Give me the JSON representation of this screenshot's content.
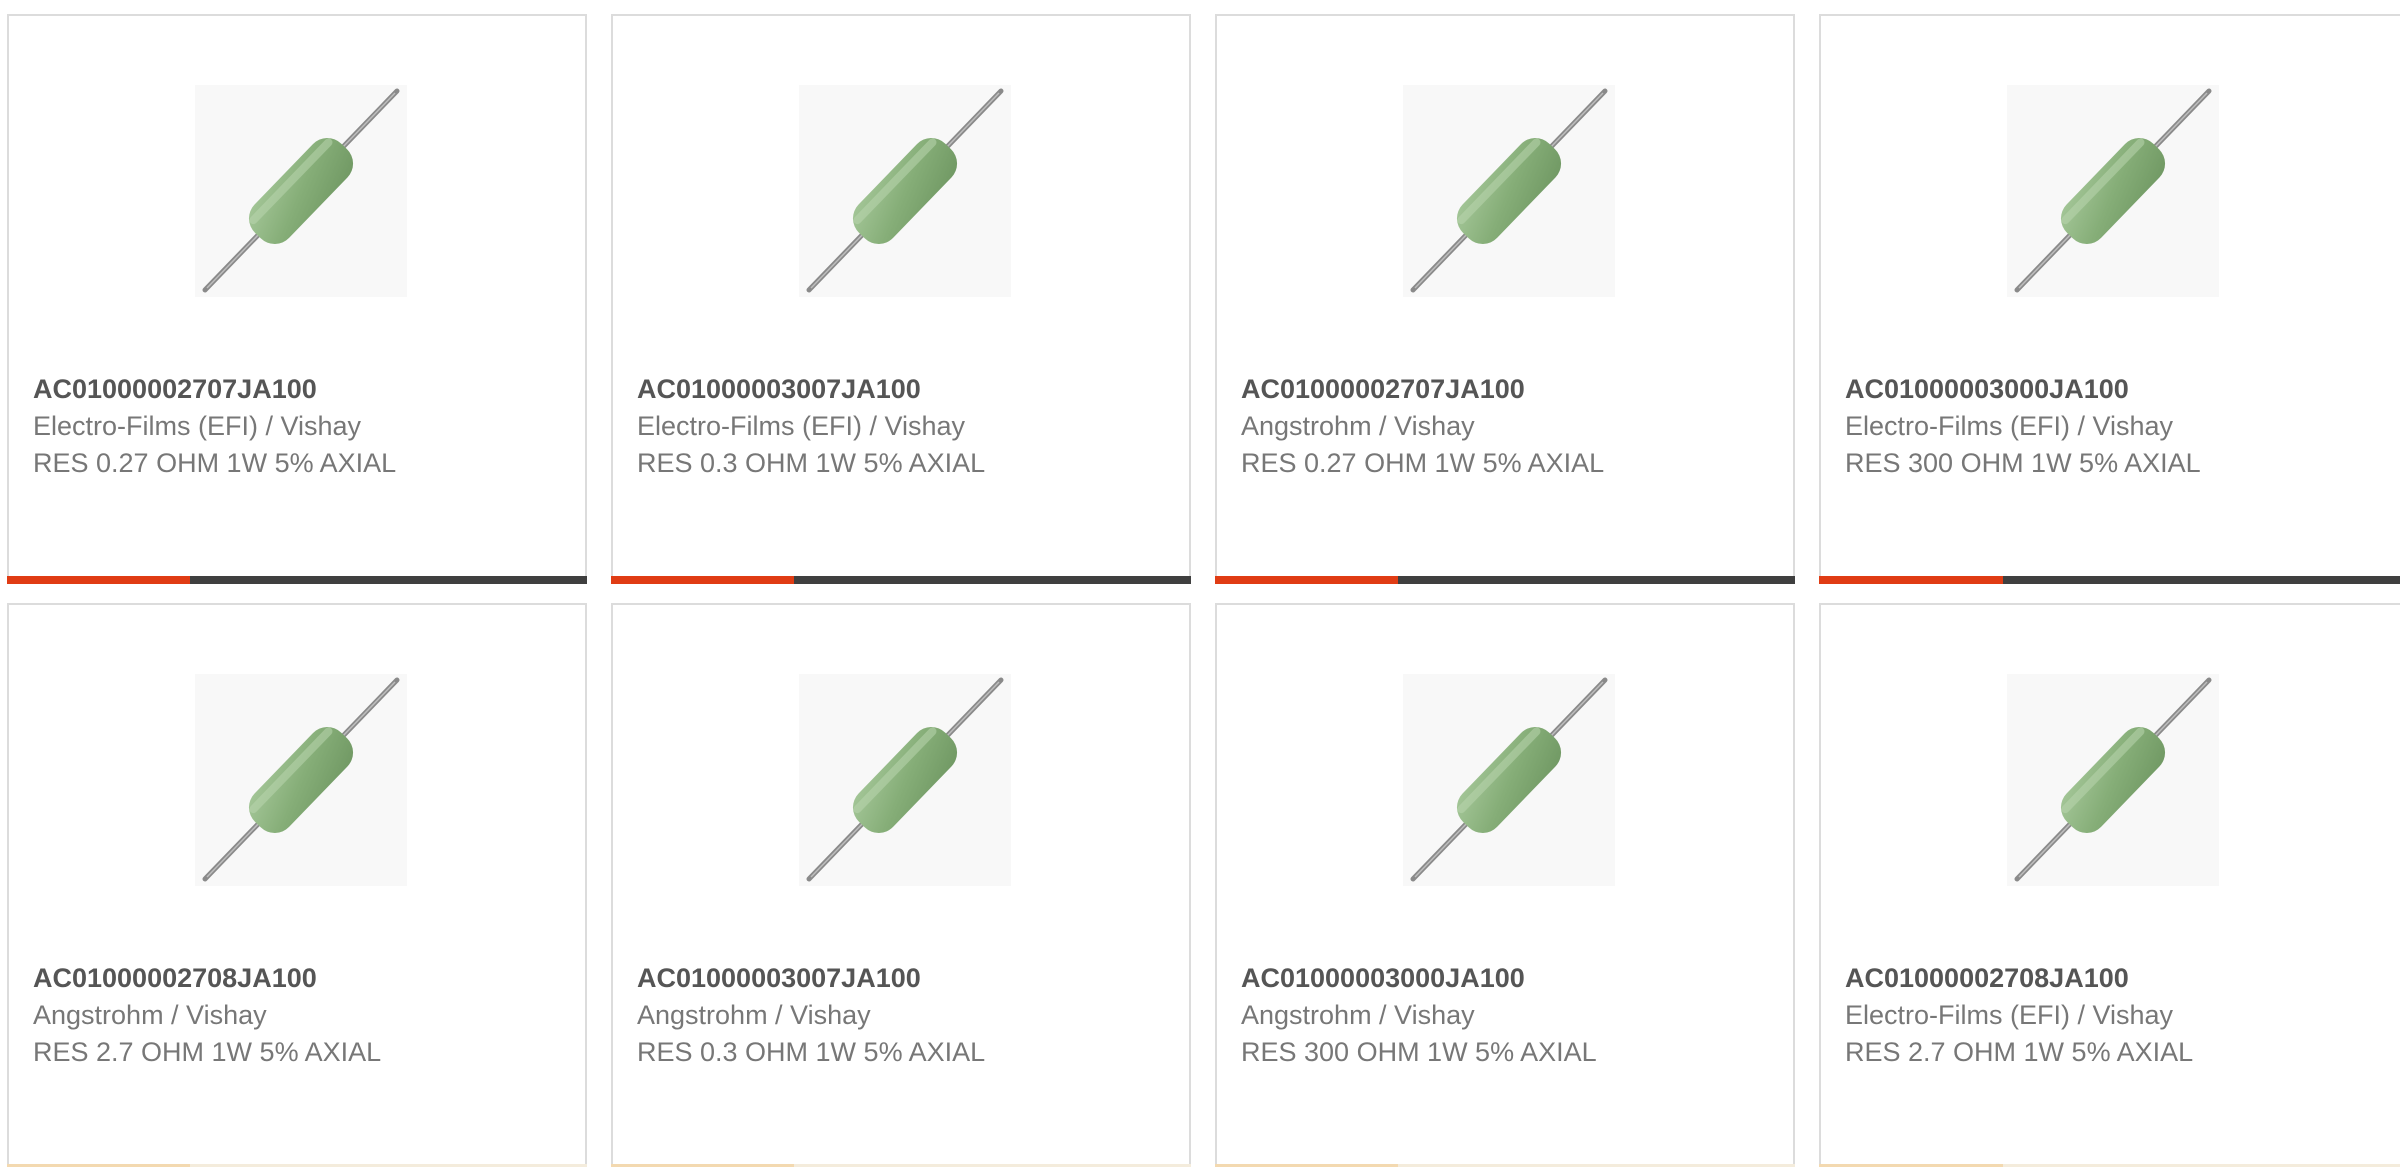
{
  "accent_color": "#e03c14",
  "bar_track_color": "#3f3f3f",
  "products": [
    {
      "part": "AC01000002707JA100",
      "manufacturer": "Electro-Films (EFI) / Vishay",
      "description": "RES 0.27 OHM 1W 5% AXIAL",
      "image_icon": "axial-resistor-icon",
      "bar_fill_fraction": 0.315
    },
    {
      "part": "AC01000003007JA100",
      "manufacturer": "Electro-Films (EFI) / Vishay",
      "description": "RES 0.3 OHM 1W 5% AXIAL",
      "image_icon": "axial-resistor-icon",
      "bar_fill_fraction": 0.315
    },
    {
      "part": "AC01000002707JA100",
      "manufacturer": "Angstrohm / Vishay",
      "description": "RES 0.27 OHM 1W 5% AXIAL",
      "image_icon": "axial-resistor-icon",
      "bar_fill_fraction": 0.315
    },
    {
      "part": "AC01000003000JA100",
      "manufacturer": "Electro-Films (EFI) / Vishay",
      "description": "RES 300 OHM 1W 5% AXIAL",
      "image_icon": "axial-resistor-icon",
      "bar_fill_fraction": 0.315
    },
    {
      "part": "AC01000002708JA100",
      "manufacturer": "Angstrohm / Vishay",
      "description": "RES 2.7 OHM 1W 5% AXIAL",
      "image_icon": "axial-resistor-icon",
      "bar_fill_fraction": 0.315
    },
    {
      "part": "AC01000003007JA100",
      "manufacturer": "Angstrohm / Vishay",
      "description": "RES 0.3 OHM 1W 5% AXIAL",
      "image_icon": "axial-resistor-icon",
      "bar_fill_fraction": 0.315
    },
    {
      "part": "AC01000003000JA100",
      "manufacturer": "Angstrohm / Vishay",
      "description": "RES 300 OHM 1W 5% AXIAL",
      "image_icon": "axial-resistor-icon",
      "bar_fill_fraction": 0.315
    },
    {
      "part": "AC01000002708JA100",
      "manufacturer": "Electro-Films (EFI) / Vishay",
      "description": "RES 2.7 OHM 1W 5% AXIAL",
      "image_icon": "axial-resistor-icon",
      "bar_fill_fraction": 0.315
    }
  ]
}
